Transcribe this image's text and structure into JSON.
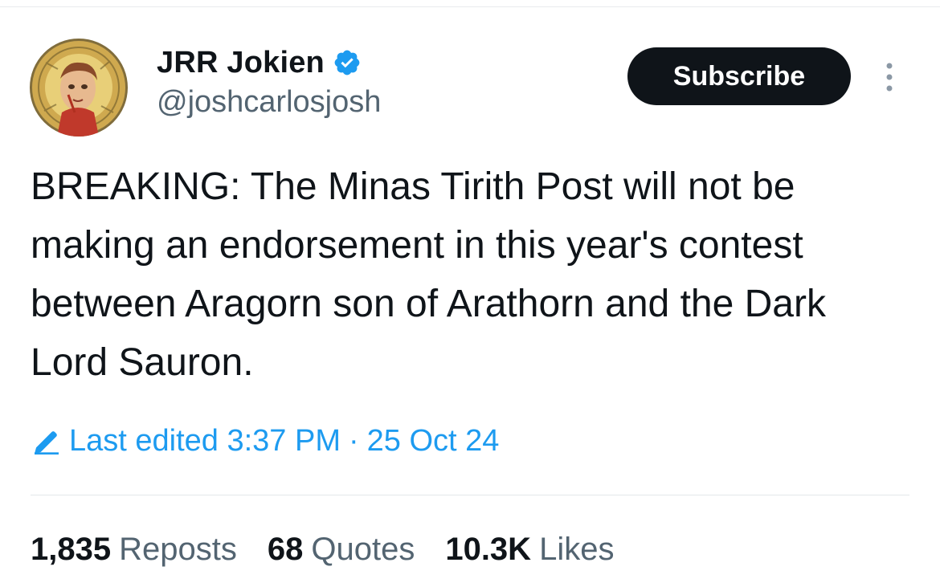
{
  "tweet": {
    "author": {
      "display_name": "JRR Jokien",
      "handle": "@joshcarlosjosh",
      "verified": true,
      "avatar_icon": "portrait-avatar"
    },
    "actions": {
      "subscribe_label": "Subscribe",
      "more_icon": "more-vertical-icon"
    },
    "text": "BREAKING: The Minas Tirith Post will not be making an endorsement in this year's contest between Aragorn son of Arathorn and the Dark Lord Sauron.",
    "edit_info": {
      "label": "Last edited 3:37 PM",
      "separator": "·",
      "date": "25 Oct 24"
    },
    "stats": [
      {
        "count": "1,835",
        "label": "Reposts"
      },
      {
        "count": "68",
        "label": "Quotes"
      },
      {
        "count": "10.3K",
        "label": "Likes"
      }
    ]
  },
  "colors": {
    "text_primary": "#0f1419",
    "text_secondary": "#536471",
    "accent_blue": "#1d9bf0",
    "button_bg": "#0f1419",
    "button_text": "#ffffff",
    "divider": "#e3e7ea"
  }
}
